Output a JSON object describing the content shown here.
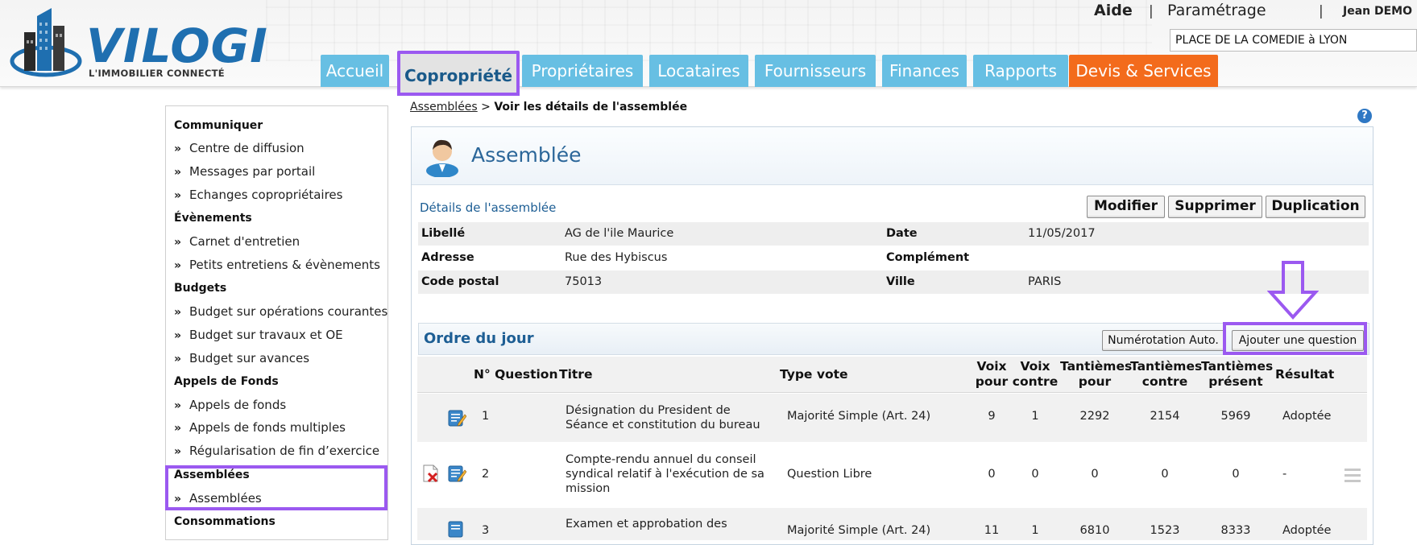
{
  "header": {
    "logo_text": "VILOGI",
    "logo_tagline": "L'IMMOBILIER CONNECTÉ",
    "links": {
      "help": "Aide",
      "settings": "Paramétrage",
      "separator": "|",
      "user": "Jean DEMO"
    },
    "site_selector": "PLACE DE LA COMEDIE à LYON",
    "tabs": [
      {
        "label": "Accueil"
      },
      {
        "label": "Copropriété"
      },
      {
        "label": "Propriétaires"
      },
      {
        "label": "Locataires"
      },
      {
        "label": "Fournisseurs"
      },
      {
        "label": "Finances"
      },
      {
        "label": "Rapports"
      },
      {
        "label": "Devis & Services"
      }
    ],
    "active_tab": "Copropriété",
    "colors": {
      "tab": "#67bfe3",
      "tab_orange": "#f36b1c",
      "highlight": "#9b59f0"
    }
  },
  "sidebar": {
    "chevron": "»",
    "sections": [
      {
        "title": "Communiquer",
        "items": [
          "Centre de diffusion",
          "Messages par portail",
          "Echanges copropriétaires"
        ]
      },
      {
        "title": "Évènements",
        "items": [
          "Carnet d'entretien",
          "Petits entretiens & évènements"
        ]
      },
      {
        "title": "Budgets",
        "items": [
          "Budget sur opérations courantes",
          "Budget sur travaux et OE",
          "Budget sur avances"
        ]
      },
      {
        "title": "Appels de Fonds",
        "items": [
          "Appels de fonds",
          "Appels de fonds multiples",
          "Régularisation de fin d’exercice"
        ]
      },
      {
        "title": "Assemblées",
        "items": [
          "Assemblées"
        ]
      },
      {
        "title": "Consommations",
        "items": []
      }
    ]
  },
  "breadcrumb": {
    "link": "Assemblées",
    "separator": ">",
    "current": "Voir les détails de l'assemblée"
  },
  "panel": {
    "title": "Assemblée",
    "details_label": "Détails de l'assemblée",
    "buttons": {
      "edit": "Modifier",
      "delete": "Supprimer",
      "duplicate": "Duplication"
    },
    "details": [
      {
        "label1": "Libellé",
        "value1": "AG de l'ile Maurice",
        "label2": "Date",
        "value2": "11/05/2017"
      },
      {
        "label1": "Adresse",
        "value1": "Rue des Hybiscus",
        "label2": "Complément",
        "value2": ""
      },
      {
        "label1": "Code postal",
        "value1": "75013",
        "label2": "Ville",
        "value2": "PARIS"
      }
    ]
  },
  "agenda": {
    "title": "Ordre du jour",
    "auto_number_button": "Numérotation Auto.",
    "add_question_button": "Ajouter une question",
    "columns": {
      "number": "N° Question",
      "title": "Titre",
      "vote_type": "Type vote",
      "votes_for": [
        "Voix",
        "pour"
      ],
      "votes_against": [
        "Voix",
        "contre"
      ],
      "shares_for": [
        "Tantièmes",
        "pour"
      ],
      "shares_against": [
        "Tantièmes",
        "contre"
      ],
      "shares_present": [
        "Tantièmes",
        "présent"
      ],
      "result": "Résultat"
    },
    "rows": [
      {
        "number": "1",
        "title": "Désignation du President de Séance et constitution du bureau",
        "vote_type": "Majorité Simple (Art. 24)",
        "votes_for": "9",
        "votes_against": "1",
        "shares_for": "2292",
        "shares_against": "2154",
        "shares_present": "5969",
        "result": "Adoptée"
      },
      {
        "number": "2",
        "title": "Compte-rendu annuel du conseil syndical relatif à l'exécution de sa mission",
        "vote_type": "Question Libre",
        "votes_for": "0",
        "votes_against": "0",
        "shares_for": "0",
        "shares_against": "0",
        "shares_present": "0",
        "result": "-"
      },
      {
        "number": "3",
        "title": "Examen et approbation des",
        "vote_type": "Majorité Simple (Art. 24)",
        "votes_for": "11",
        "votes_against": "1",
        "shares_for": "6810",
        "shares_against": "1523",
        "shares_present": "8333",
        "result": "Adoptée"
      }
    ]
  }
}
